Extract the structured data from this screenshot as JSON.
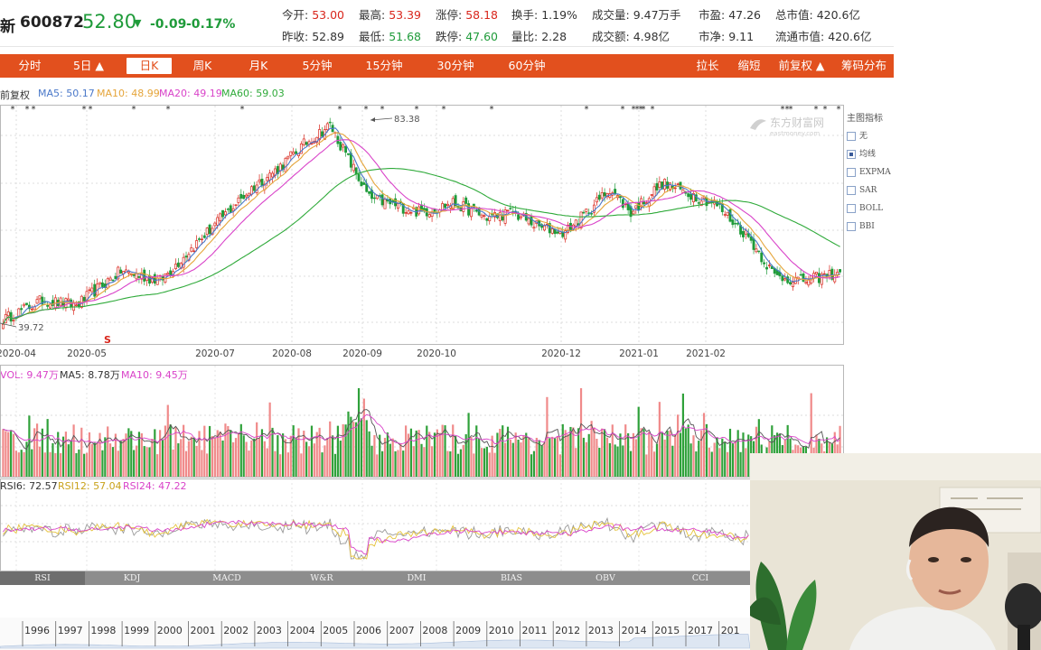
{
  "colors": {
    "up": "#d9261c",
    "down": "#1f9b3a",
    "toolbar": "#e2501e",
    "ma5": "#4a78c9",
    "ma10": "#e5a53a",
    "ma20": "#d943c9",
    "ma60": "#2faa3a"
  },
  "quote": {
    "name": "新",
    "code": "600872",
    "price": "52.80",
    "arrow": "▼",
    "change": "-0.09",
    "change_pct": "-0.17%",
    "open_label": "今开:",
    "open": "53.00",
    "high_label": "最高:",
    "high": "53.39",
    "limit_up_label": "涨停:",
    "limit_up": "58.18",
    "turnover_label": "换手:",
    "turnover": "1.19%",
    "volume_label": "成交量:",
    "volume": "9.47万手",
    "pe_label": "市盈:",
    "pe": "47.26",
    "mcap_label": "总市值:",
    "mcap": "420.6亿",
    "prev_close_label": "昨收:",
    "prev_close": "52.89",
    "low_label": "最低:",
    "low": "51.68",
    "limit_down_label": "跌停:",
    "limit_down": "47.60",
    "vol_ratio_label": "量比:",
    "vol_ratio": "2.28",
    "amount_label": "成交额:",
    "amount": "4.98亿",
    "pb_label": "市净:",
    "pb": "9.11",
    "float_mcap_label": "流通市值:",
    "float_mcap": "420.6亿"
  },
  "toolbar": {
    "tabs": [
      "分时",
      "5日 ▲",
      "日K",
      "周K",
      "月K",
      "5分钟",
      "15分钟",
      "30分钟",
      "60分钟"
    ],
    "active": "日K",
    "right": [
      "拉长",
      "缩短",
      "前复权 ▲",
      "筹码分布"
    ]
  },
  "legend": {
    "fq": "前复权",
    "ma5": "MA5: 50.17",
    "ma10": "MA10: 48.99",
    "ma20": "MA20: 49.19",
    "ma60": "MA60: 59.03",
    "vol": "VOL: 9.47万",
    "vol_ma5": "MA5: 8.78万",
    "vol_ma10": "MA10: 9.45万",
    "rsi6": "RSI6: 72.57",
    "rsi12": "RSI12: 57.04",
    "rsi24": "RSI24: 47.22"
  },
  "annotations": {
    "high": "83.38",
    "low": "39.72",
    "s_mark": "S"
  },
  "watermark": "东方财富网",
  "watermark_sub": "eastmoney.com",
  "side_panel": {
    "title": "主图指标",
    "options": [
      {
        "label": "无",
        "checked": false
      },
      {
        "label": "均线",
        "checked": true
      },
      {
        "label": "EXPMA",
        "checked": false
      },
      {
        "label": "SAR",
        "checked": false
      },
      {
        "label": "BOLL",
        "checked": false
      },
      {
        "label": "BBI",
        "checked": false
      }
    ]
  },
  "indicator_tabs": [
    "RSI",
    "KDJ",
    "MACD",
    "W&R",
    "DMI",
    "BIAS",
    "OBV",
    "CCI"
  ],
  "indicator_active": "RSI",
  "timeline_years": [
    "1996",
    "1997",
    "1998",
    "1999",
    "2000",
    "2001",
    "2002",
    "2003",
    "2004",
    "2005",
    "2006",
    "2007",
    "2008",
    "2009",
    "2010",
    "2011",
    "2012",
    "2013",
    "2014",
    "2015",
    "2017",
    "201"
  ],
  "chart_data": [
    {
      "type": "candlestick",
      "title": "",
      "x_tick_labels": [
        "2020-04",
        "2020-05",
        "2020-07",
        "2020-08",
        "2020-09",
        "2020-10",
        "2020-12",
        "2021-01",
        "2021-02"
      ],
      "series": [
        {
          "name": "MA5",
          "last": 50.17
        },
        {
          "name": "MA10",
          "last": 48.99
        },
        {
          "name": "MA20",
          "last": 49.19
        },
        {
          "name": "MA60",
          "last": 59.03
        }
      ],
      "ylim": [
        38,
        87
      ],
      "annotations": [
        {
          "label": "83.38",
          "kind": "high"
        },
        {
          "label": "39.72",
          "kind": "low"
        }
      ],
      "anchors": [
        [
          0,
          43
        ],
        [
          15,
          47
        ],
        [
          28,
          46
        ],
        [
          45,
          53
        ],
        [
          60,
          51
        ],
        [
          80,
          62
        ],
        [
          95,
          70
        ],
        [
          105,
          74
        ],
        [
          115,
          79
        ],
        [
          125,
          83
        ],
        [
          132,
          76
        ],
        [
          140,
          68
        ],
        [
          160,
          65
        ],
        [
          172,
          67
        ],
        [
          185,
          64
        ],
        [
          195,
          65
        ],
        [
          205,
          62
        ],
        [
          215,
          61
        ],
        [
          225,
          66
        ],
        [
          232,
          70
        ],
        [
          240,
          65
        ],
        [
          252,
          71
        ],
        [
          262,
          69
        ],
        [
          272,
          67
        ],
        [
          285,
          60
        ],
        [
          295,
          52
        ],
        [
          305,
          51
        ],
        [
          315,
          52
        ],
        [
          320,
          53
        ]
      ]
    },
    {
      "type": "bar",
      "title": "",
      "series": [
        {
          "name": "VOL",
          "last": "9.47万"
        },
        {
          "name": "MA5",
          "last": "8.78万"
        },
        {
          "name": "MA10",
          "last": "9.45万"
        }
      ]
    },
    {
      "type": "line",
      "title": "",
      "series": [
        {
          "name": "RSI6",
          "last": 72.57
        },
        {
          "name": "RSI12",
          "last": 57.04
        },
        {
          "name": "RSI24",
          "last": 47.22
        }
      ]
    }
  ]
}
